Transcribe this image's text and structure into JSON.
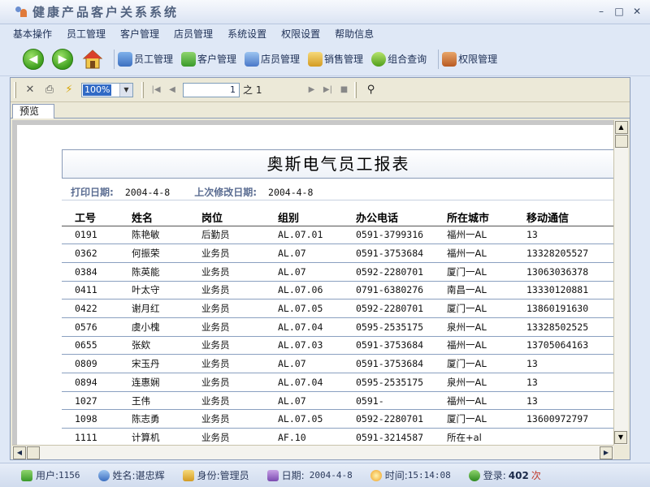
{
  "window": {
    "title": "健康产品客户关系系统"
  },
  "menu": [
    "基本操作",
    "员工管理",
    "客户管理",
    "店员管理",
    "系统设置",
    "权限设置",
    "帮助信息"
  ],
  "toolbar": {
    "buttons": [
      "员工管理",
      "客户管理",
      "店员管理",
      "销售管理",
      "组合查询",
      "权限管理"
    ]
  },
  "viewer": {
    "zoom": "100%",
    "page_current": "1",
    "page_of": "之 1",
    "tab_label": "预览"
  },
  "report": {
    "title": "奥斯电气员工报表",
    "print_date_label": "打印日期:",
    "print_date": "2004-4-8",
    "modified_date_label": "上次修改日期:",
    "modified_date": "2004-4-8",
    "columns": [
      "工号",
      "姓名",
      "岗位",
      "组别",
      "办公电话",
      "所在城市",
      "移动通信"
    ],
    "rows": [
      [
        "0191",
        "陈艳敏",
        "后勤员",
        "AL.07.01",
        "0591-3799316",
        "福州一AL",
        "13"
      ],
      [
        "0362",
        "何振荣",
        "业务员",
        "AL.07",
        "0591-3753684",
        "福州一AL",
        "13328205527"
      ],
      [
        "0384",
        "陈英能",
        "业务员",
        "AL.07",
        "0592-2280701",
        "厦门一AL",
        "13063036378"
      ],
      [
        "0411",
        "叶太守",
        "业务员",
        "AL.07.06",
        "0791-6380276",
        "南昌一AL",
        "13330120881"
      ],
      [
        "0422",
        "谢月红",
        "业务员",
        "AL.07.05",
        "0592-2280701",
        "厦门一AL",
        "13860191630"
      ],
      [
        "0576",
        "虞小槐",
        "业务员",
        "AL.07.04",
        "0595-2535175",
        "泉州一AL",
        "13328502525"
      ],
      [
        "0655",
        "张欸",
        "业务员",
        "AL.07.03",
        "0591-3753684",
        "福州一AL",
        "13705064163"
      ],
      [
        "0809",
        "宋玉丹",
        "业务员",
        "AL.07",
        "0591-3753684",
        "厦门一AL",
        "13"
      ],
      [
        "0894",
        "连惠娴",
        "业务员",
        "AL.07.04",
        "0595-2535175",
        "泉州一AL",
        "13"
      ],
      [
        "1027",
        "王伟",
        "业务员",
        "AL.07",
        "0591-",
        "福州一AL",
        "13"
      ],
      [
        "1098",
        "陈志勇",
        "业务员",
        "AL.07.05",
        "0592-2280701",
        "厦门一AL",
        "13600972797"
      ],
      [
        "1111",
        "计算机",
        "业务员",
        "AF.10",
        "0591-3214587",
        "所在+al",
        ""
      ]
    ]
  },
  "status": {
    "user_label": "用户:",
    "user_value": "1156",
    "name_label": "姓名:",
    "name_value": "谌忠辉",
    "role_label": "身份:",
    "role_value": "管理员",
    "date_label": "日期:",
    "date_value": "2004-4-8",
    "time_label": "时间:",
    "time_value": "15:14:08",
    "login_label": "登录:",
    "login_count": "402",
    "login_unit": "次"
  },
  "colors": {
    "accent": "#316ac5",
    "frame": "#dfe8f6",
    "report_label": "#5b6d92"
  }
}
